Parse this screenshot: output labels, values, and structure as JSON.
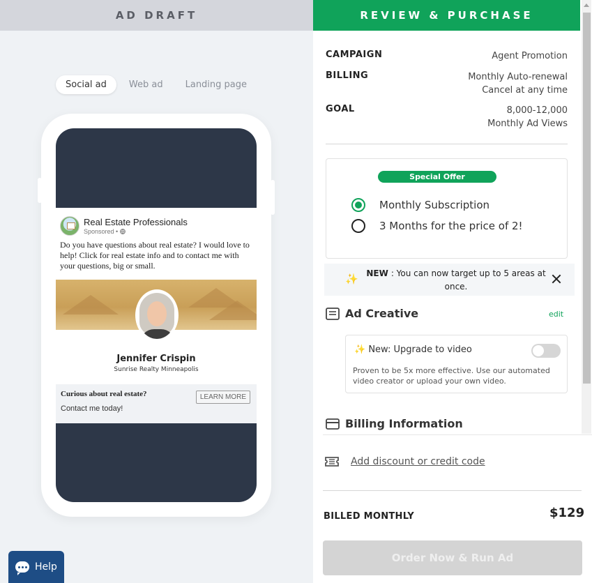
{
  "left_header": "AD DRAFT",
  "tabs": [
    {
      "label": "Social ad",
      "active": true
    },
    {
      "label": "Web ad",
      "active": false
    },
    {
      "label": "Landing page",
      "active": false
    }
  ],
  "ad": {
    "page_name": "Real Estate Professionals",
    "sponsored": "Sponsored •",
    "body": "Do you have questions about real estate? I would love to help! Click for real estate info and to contact me with your questions, big or small.",
    "agent_name": "Jennifer Crispin",
    "agent_company": "Sunrise Realty Minneapolis",
    "cta_title": "Curious about real estate?",
    "cta_subtitle": "Contact me today!",
    "cta_button": "LEARN MORE"
  },
  "help_label": "Help",
  "right_header": "REVIEW & PURCHASE",
  "summary": {
    "campaign_label": "CAMPAIGN",
    "campaign_value": "Agent Promotion",
    "billing_label": "BILLING",
    "billing_value_1": "Monthly Auto-renewal",
    "billing_value_2": "Cancel at any time",
    "goal_label": "GOAL",
    "goal_value_1": "8,000-12,000",
    "goal_value_2": "Monthly Ad Views"
  },
  "offer": {
    "badge": "Special Offer",
    "options": [
      {
        "label": "Monthly Subscription",
        "selected": true
      },
      {
        "label": "3 Months for the price of 2!",
        "selected": false
      }
    ]
  },
  "notice": {
    "bold": "NEW",
    "text": ": You can now target up to 5 areas at once."
  },
  "ad_creative": {
    "title": "Ad Creative",
    "edit": "edit",
    "video_title": "New: Upgrade to video",
    "video_desc": "Proven to be 5x more effective. Use our automated video creator or upload your own video.",
    "video_enabled": false
  },
  "billing_info": {
    "title": "Billing Information",
    "discount_link": "Add discount or credit code"
  },
  "total": {
    "label": "BILLED MONTHLY",
    "price": "$129"
  },
  "order_button": "Order Now & Run Ad",
  "colors": {
    "accent": "#10a35a",
    "help_bg": "#1e4d85",
    "phone_screen": "#2d3748"
  }
}
